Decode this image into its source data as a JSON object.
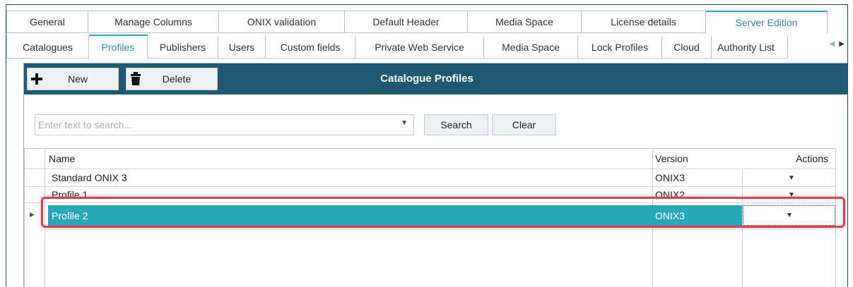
{
  "tabs_top": [
    {
      "label": "General",
      "active": false
    },
    {
      "label": "Manage Columns",
      "active": false
    },
    {
      "label": "ONIX validation",
      "active": false
    },
    {
      "label": "Default Header",
      "active": false
    },
    {
      "label": "Media Space",
      "active": false
    },
    {
      "label": "License details",
      "active": false
    },
    {
      "label": "Server Edition",
      "active": true
    }
  ],
  "tabs_sub": [
    {
      "label": "Catalogues",
      "active": false
    },
    {
      "label": "Profiles",
      "active": true
    },
    {
      "label": "Publishers",
      "active": false
    },
    {
      "label": "Users",
      "active": false
    },
    {
      "label": "Custom fields",
      "active": false
    },
    {
      "label": "Private Web Service",
      "active": false
    },
    {
      "label": "Media Space",
      "active": false
    },
    {
      "label": "Lock Profiles",
      "active": false
    },
    {
      "label": "Cloud",
      "active": false
    },
    {
      "label": "Authority List",
      "active": false
    }
  ],
  "toolbar": {
    "new_label": "New",
    "delete_label": "Delete",
    "title": "Catalogue Profiles"
  },
  "search": {
    "placeholder": "Enter text to search...",
    "search_label": "Search",
    "clear_label": "Clear"
  },
  "grid": {
    "headers": {
      "name": "Name",
      "version": "Version",
      "actions": "Actions"
    },
    "rows": [
      {
        "name": "Standard ONIX 3",
        "version": "ONIX3",
        "selected": false
      },
      {
        "name": "Profile 1",
        "version": "ONIX2",
        "selected": false
      },
      {
        "name": "Profile 2",
        "version": "ONIX3",
        "selected": true
      }
    ]
  },
  "colors": {
    "toolbar_bg": "#1f5a73",
    "selection": "#2aa7b8",
    "active_tab_text": "#2a8fb3",
    "highlight": "#e8394a"
  }
}
